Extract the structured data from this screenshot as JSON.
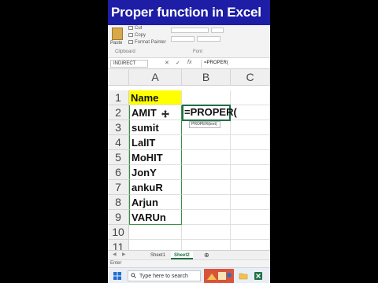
{
  "banner": {
    "title": "Proper function in Excel"
  },
  "ribbon": {
    "paste_label": "Paste",
    "cut_label": "Cut",
    "copy_label": "Copy",
    "format_painter_label": "Format Painter",
    "clipboard_group": "Clipboard",
    "font_group": "Font"
  },
  "formula_bar": {
    "name_box": "INDIRECT",
    "cancel_symbol": "✕",
    "enter_symbol": "✓",
    "fx_symbol": "fx",
    "content": "=PROPER("
  },
  "grid": {
    "columns": [
      "A",
      "B",
      "C"
    ],
    "rows": [
      "1",
      "2",
      "3",
      "4",
      "5",
      "6",
      "7",
      "8",
      "9",
      "10",
      "11"
    ],
    "header_cell": "Name",
    "names": [
      "AMIT",
      "sumit",
      "LalIT",
      "MoHIT",
      "JonY",
      "ankuR",
      "Arjun",
      "VARUn"
    ],
    "active_formula": "=PROPER(",
    "tooltip": "PROPER(text)",
    "highlight_color": "#ffff00",
    "border_color": "#1e7145"
  },
  "sheets": {
    "tabs": [
      "Sheet1",
      "Sheet2"
    ],
    "active": "Sheet2",
    "add_symbol": "⊕"
  },
  "status": {
    "mode": "Enter"
  },
  "taskbar": {
    "search_placeholder": "Type here to search"
  },
  "colors": {
    "banner_bg": "#1d1da6",
    "excel_green": "#1e7145"
  }
}
